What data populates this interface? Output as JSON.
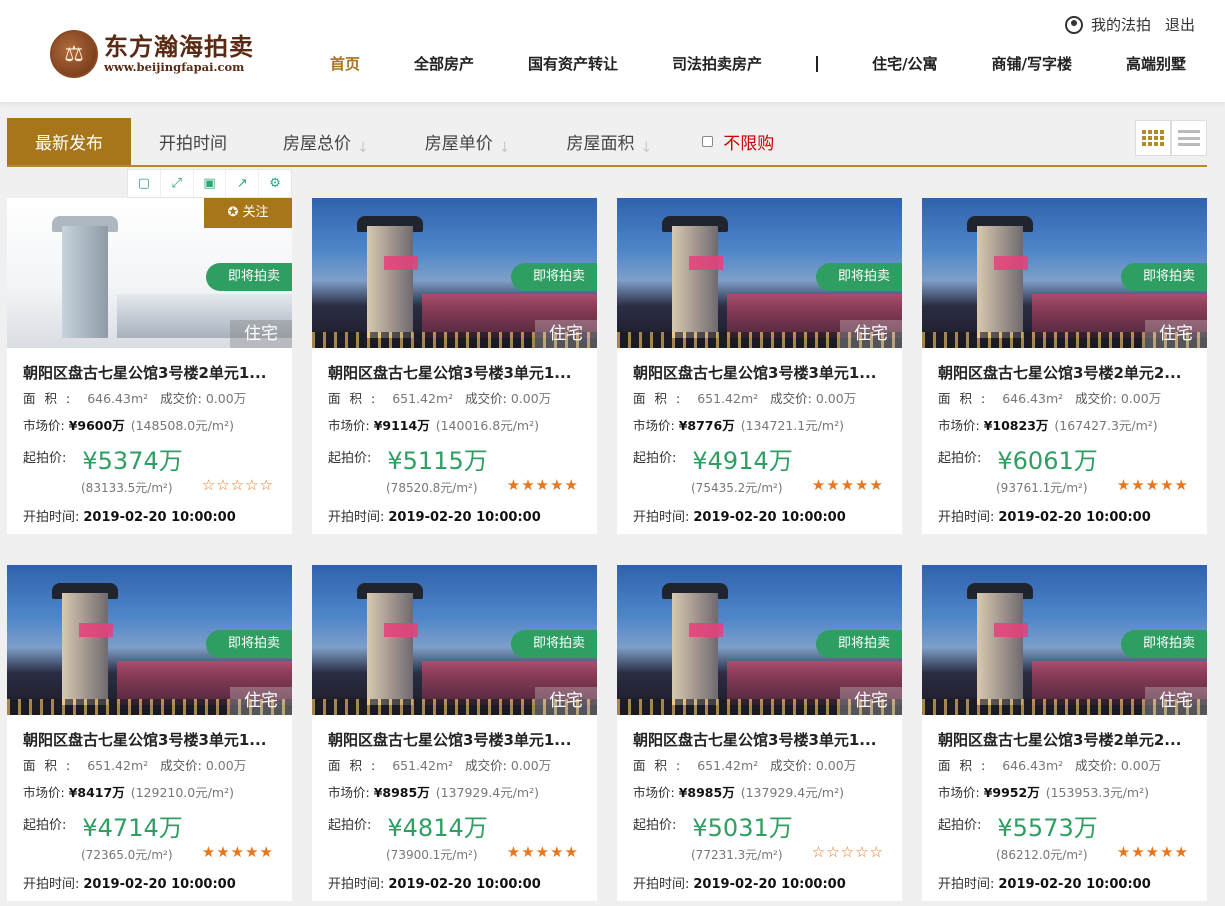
{
  "header": {
    "logo_cn": "东方瀚海拍卖",
    "logo_url": "www.beijingfapai.com",
    "user_link": "我的法拍",
    "logout": "退出"
  },
  "nav": {
    "items": [
      "首页",
      "全部房产",
      "国有资产转让",
      "司法拍卖房产",
      "住宅/公寓",
      "商铺/写字楼",
      "高端别墅"
    ],
    "active_index": 0
  },
  "filter": {
    "tabs": [
      "最新发布",
      "开拍时间",
      "房屋总价",
      "房屋单价",
      "房屋面积"
    ],
    "active_tab": 0,
    "unlimited_label": "不限购"
  },
  "labels": {
    "area": "面积:",
    "deal": "成交价:",
    "market": "市场价:",
    "start": "起拍价:",
    "time": "开拍时间:",
    "soon": "即将拍卖",
    "follow": "关注"
  },
  "cards": [
    {
      "title": "朝阳区盘古七星公馆3号楼2单元1...",
      "area": "646.43m²",
      "deal": "0.00万",
      "market": "¥9600万",
      "market_unit": "(148508.0元/m²)",
      "start": "¥5374万",
      "start_unit": "(83133.5元/m²)",
      "stars": "☆☆☆☆☆",
      "time": "2019-02-20 10:00:00",
      "type": "住宅",
      "follow": true
    },
    {
      "title": "朝阳区盘古七星公馆3号楼3单元1...",
      "area": "651.42m²",
      "deal": "0.00万",
      "market": "¥9114万",
      "market_unit": "(140016.8元/m²)",
      "start": "¥5115万",
      "start_unit": "(78520.8元/m²)",
      "stars": "★★★★★",
      "time": "2019-02-20 10:00:00",
      "type": "住宅",
      "follow": false
    },
    {
      "title": "朝阳区盘古七星公馆3号楼3单元1...",
      "area": "651.42m²",
      "deal": "0.00万",
      "market": "¥8776万",
      "market_unit": "(134721.1元/m²)",
      "start": "¥4914万",
      "start_unit": "(75435.2元/m²)",
      "stars": "★★★★★",
      "time": "2019-02-20 10:00:00",
      "type": "住宅",
      "follow": false
    },
    {
      "title": "朝阳区盘古七星公馆3号楼2单元2...",
      "area": "646.43m²",
      "deal": "0.00万",
      "market": "¥10823万",
      "market_unit": "(167427.3元/m²)",
      "start": "¥6061万",
      "start_unit": "(93761.1元/m²)",
      "stars": "★★★★★",
      "time": "2019-02-20 10:00:00",
      "type": "住宅",
      "follow": false
    },
    {
      "title": "朝阳区盘古七星公馆3号楼3单元1...",
      "area": "651.42m²",
      "deal": "0.00万",
      "market": "¥8417万",
      "market_unit": "(129210.0元/m²)",
      "start": "¥4714万",
      "start_unit": "(72365.0元/m²)",
      "stars": "★★★★★",
      "time": "2019-02-20 10:00:00",
      "type": "住宅",
      "follow": false
    },
    {
      "title": "朝阳区盘古七星公馆3号楼3单元1...",
      "area": "651.42m²",
      "deal": "0.00万",
      "market": "¥8985万",
      "market_unit": "(137929.4元/m²)",
      "start": "¥4814万",
      "start_unit": "(73900.1元/m²)",
      "stars": "★★★★★",
      "time": "2019-02-20 10:00:00",
      "type": "住宅",
      "follow": false
    },
    {
      "title": "朝阳区盘古七星公馆3号楼3单元1...",
      "area": "651.42m²",
      "deal": "0.00万",
      "market": "¥8985万",
      "market_unit": "(137929.4元/m²)",
      "start": "¥5031万",
      "start_unit": "(77231.3元/m²)",
      "stars": "☆☆☆☆☆",
      "time": "2019-02-20 10:00:00",
      "type": "住宅",
      "follow": false
    },
    {
      "title": "朝阳区盘古七星公馆3号楼2单元2...",
      "area": "646.43m²",
      "deal": "0.00万",
      "market": "¥9952万",
      "market_unit": "(153953.3元/m²)",
      "start": "¥5573万",
      "start_unit": "(86212.0元/m²)",
      "stars": "★★★★★",
      "time": "2019-02-20 10:00:00",
      "type": "住宅",
      "follow": false
    }
  ],
  "colors": {
    "accent": "#a8761a",
    "price_green": "#2f9e62",
    "star_orange": "#e8761c",
    "unlimited_red": "#cc0000"
  }
}
